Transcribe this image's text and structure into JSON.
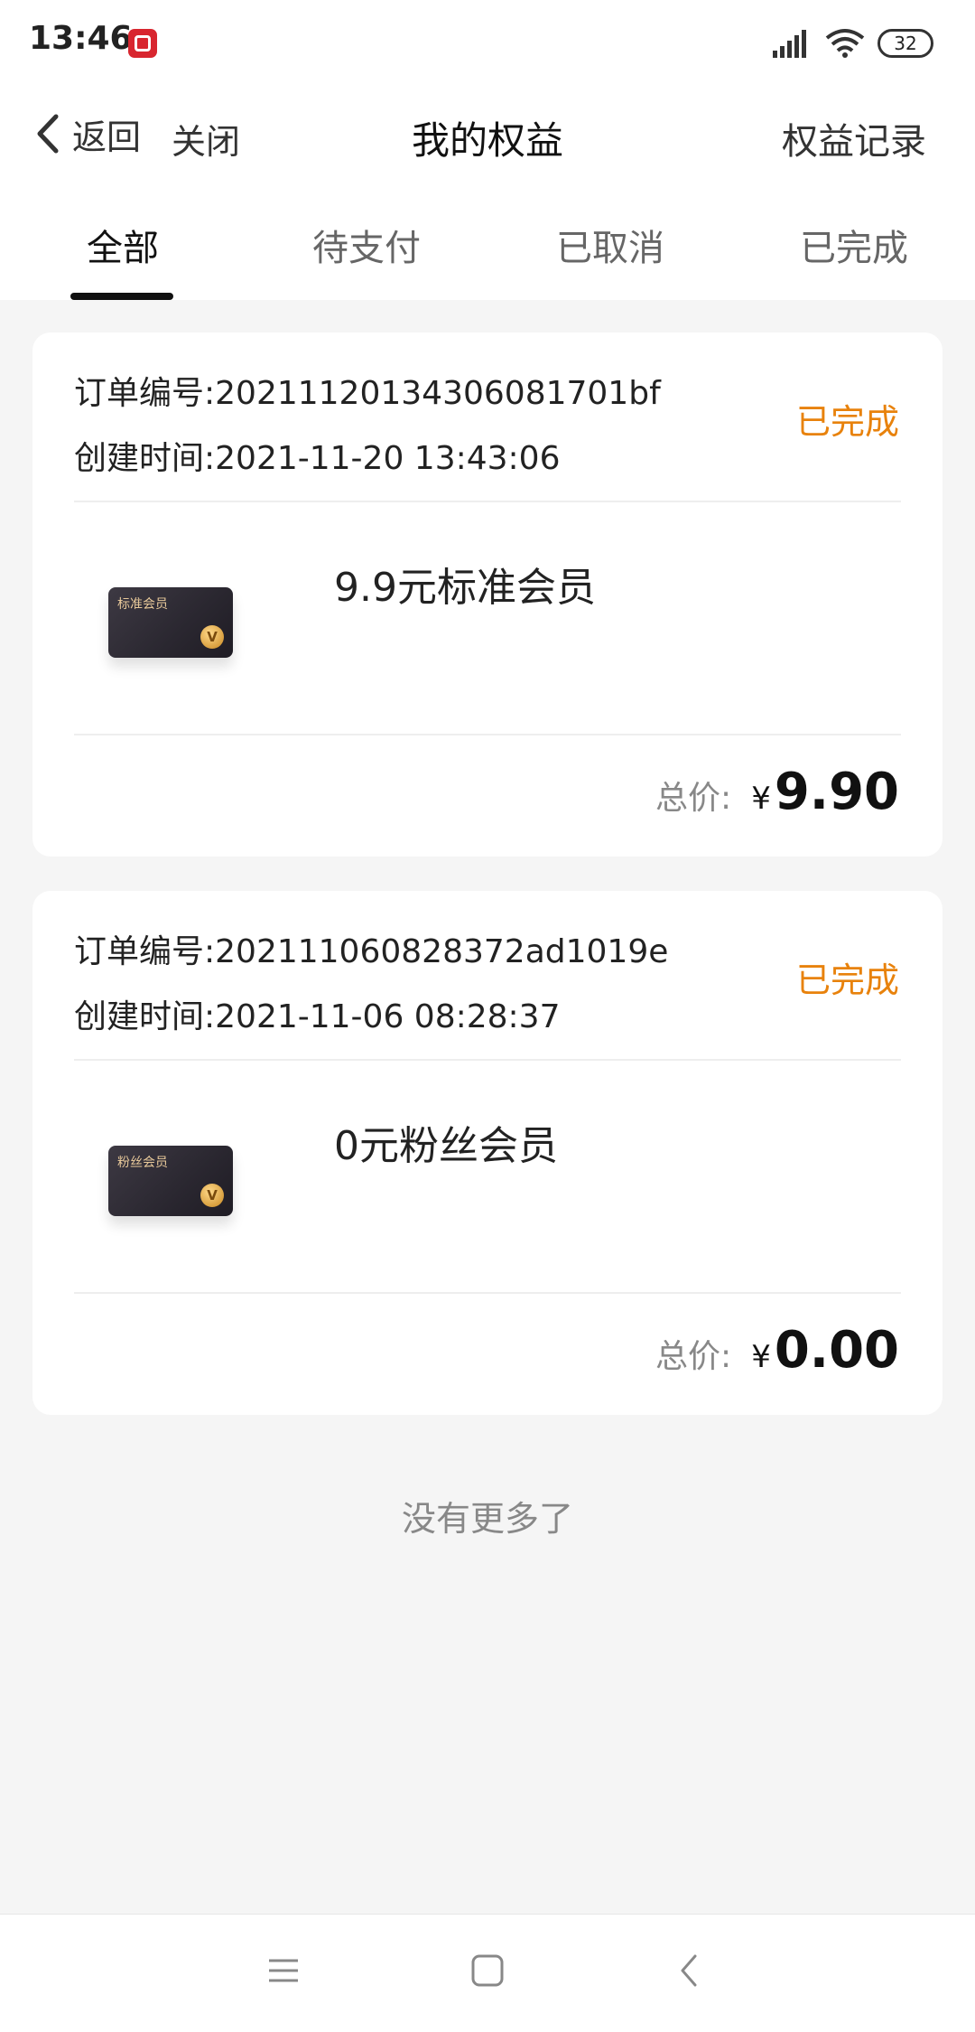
{
  "status_bar": {
    "time": "13:46",
    "battery": "32"
  },
  "nav": {
    "back_label": "返回",
    "close_label": "关闭",
    "title": "我的权益",
    "right_label": "权益记录"
  },
  "tabs": [
    {
      "label": "全部",
      "active": true
    },
    {
      "label": "待支付",
      "active": false
    },
    {
      "label": "已取消",
      "active": false
    },
    {
      "label": "已完成",
      "active": false
    }
  ],
  "orders": [
    {
      "order_no": "订单编号:20211120134306081701bf",
      "created": "创建时间:2021-11-20 13:43:06",
      "status": "已完成",
      "product": "9.9元标准会员",
      "thumb_label": "标准会员",
      "price_label": "总价:",
      "currency": "¥",
      "price": "9.90"
    },
    {
      "order_no": "订单编号:202111060828372ad1019e",
      "created": "创建时间:2021-11-06 08:28:37",
      "status": "已完成",
      "product": "0元粉丝会员",
      "thumb_label": "粉丝会员",
      "price_label": "总价:",
      "currency": "¥",
      "price": "0.00"
    }
  ],
  "footer": {
    "no_more": "没有更多了"
  },
  "colors": {
    "status": "#e8820c",
    "background": "#f5f5f5",
    "card": "#ffffff"
  },
  "icons": [
    "back-chevron-icon",
    "signal-icon",
    "wifi-icon",
    "battery-icon",
    "menu-icon",
    "home-icon",
    "back-icon"
  ]
}
